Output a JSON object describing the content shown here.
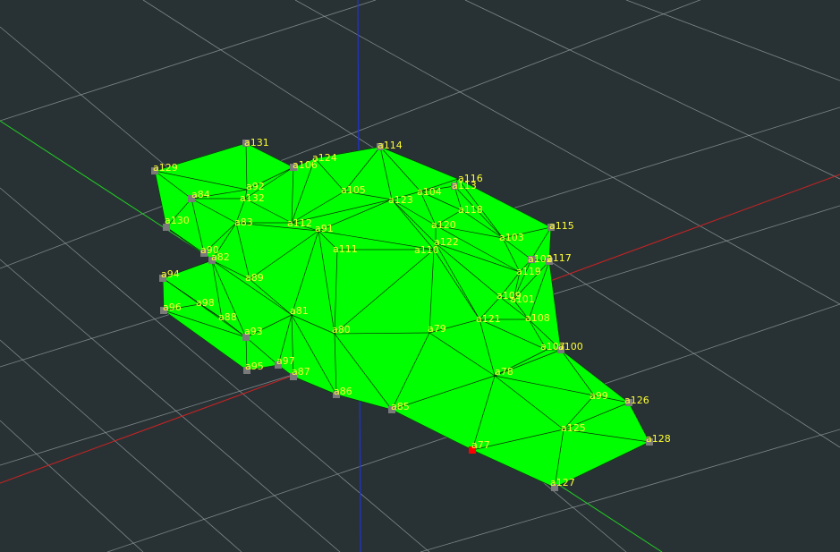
{
  "scene": {
    "background": "#283235",
    "grid_color": "#9aa3a6",
    "mesh_fill": "#00ff00",
    "edge_color": "#0a0a0a",
    "label_color": "#ffff33",
    "vertex_color": "#7a7a7a",
    "selected_vertex_color": "#ff0000",
    "axis_colors": {
      "x": "#cc2222",
      "y": "#22cc22",
      "z": "#2233cc"
    },
    "selected_vertex": "a77"
  },
  "vertices": [
    "a77",
    "a78",
    "a79",
    "a80",
    "a81",
    "a82",
    "a83",
    "a84",
    "a85",
    "a86",
    "a87",
    "a88",
    "a89",
    "a90",
    "a91",
    "a92",
    "a93",
    "a94",
    "a95",
    "a96",
    "a97",
    "a98",
    "a99",
    "a100",
    "a101",
    "a102",
    "a103",
    "a104",
    "a105",
    "a106",
    "a107",
    "a108",
    "a109",
    "a110",
    "a111",
    "a112",
    "a113",
    "a114",
    "a115",
    "a116",
    "a117",
    "a118",
    "a119",
    "a120",
    "a121",
    "a122",
    "a123",
    "a124",
    "a125",
    "a126",
    "a127",
    "a128",
    "a129",
    "a130",
    "a131",
    "a132"
  ]
}
